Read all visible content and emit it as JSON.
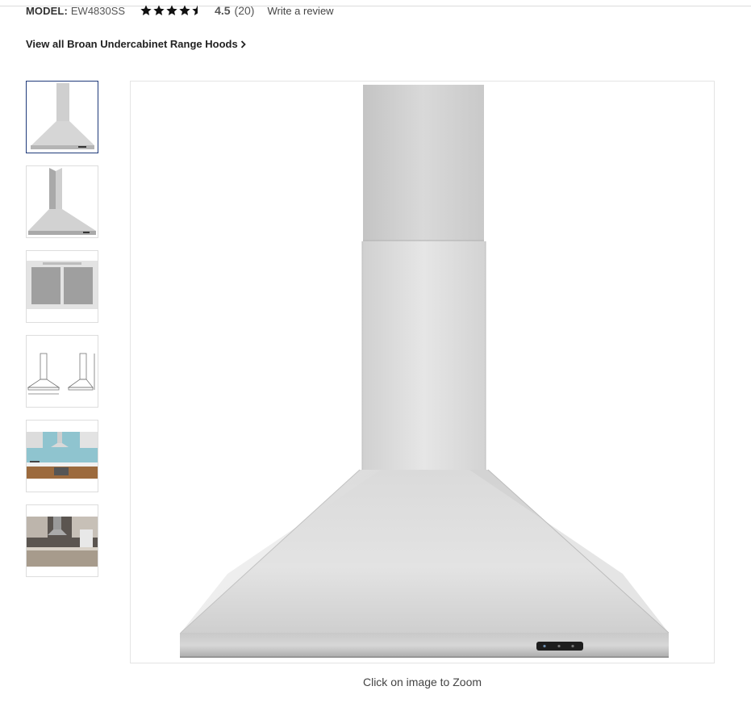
{
  "product": {
    "model_label": "MODEL:",
    "model_value": "EW4830SS",
    "rating_value": "4.5",
    "rating_count": "(20)",
    "rating_stars": 4.5,
    "write_review": "Write a review"
  },
  "collection_link": {
    "label": "View all Broan Undercabinet Range Hoods"
  },
  "gallery": {
    "thumbnails": [
      {
        "name": "front-view",
        "selected": true
      },
      {
        "name": "angled-view",
        "selected": false
      },
      {
        "name": "filters-view",
        "selected": false
      },
      {
        "name": "dimensions-diagram",
        "selected": false
      },
      {
        "name": "blue-kitchen-scene",
        "selected": false
      },
      {
        "name": "dark-kitchen-scene",
        "selected": false
      }
    ],
    "zoom_caption": "Click on image to Zoom"
  },
  "colors": {
    "accent_border": "#1f3a7a",
    "star": "#111111"
  }
}
